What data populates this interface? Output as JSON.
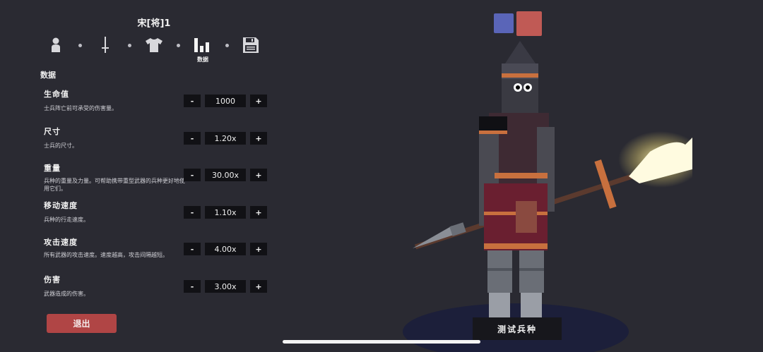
{
  "unit": {
    "name": "宋[将]1"
  },
  "tabs": [
    {
      "icon": "person-icon"
    },
    {
      "icon": "sword-icon"
    },
    {
      "icon": "shirt-icon"
    },
    {
      "icon": "stats-bar-icon",
      "label": "数据",
      "active": true
    },
    {
      "icon": "save-icon"
    }
  ],
  "section": {
    "title": "数据"
  },
  "stats": [
    {
      "name": "生命值",
      "description": "士兵阵亡前可承受的伤害量。",
      "value": "1000"
    },
    {
      "name": "尺寸",
      "description": "士兵的尺寸。",
      "value": "1.20x"
    },
    {
      "name": "重量",
      "description": "兵种的重量及力量。可帮助携带重型武器的兵种更好地使用它们。",
      "value": "30.00x"
    },
    {
      "name": "移动速度",
      "description": "兵种的行走速度。",
      "value": "1.10x"
    },
    {
      "name": "攻击速度",
      "description": "所有武器的攻击速度。速度越高，攻击间隔越短。",
      "value": "4.00x"
    },
    {
      "name": "伤害",
      "description": "武器造成的伤害。",
      "value": "3.00x"
    }
  ],
  "stepper": {
    "minus": "-",
    "plus": "+"
  },
  "buttons": {
    "exit": "退出",
    "test": "测试兵种"
  },
  "team_colors": {
    "blue": "#5a65b8",
    "red": "#c05a55"
  },
  "accent": {
    "exit_button": "#b04545"
  }
}
